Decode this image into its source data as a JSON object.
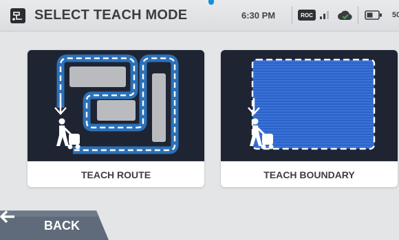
{
  "header": {
    "title": "SELECT TEACH MODE",
    "time": "6:30 PM",
    "mode_badge": "ROC",
    "battery_text": "50"
  },
  "cards": [
    {
      "label": "TEACH ROUTE",
      "icon": "route-illustration"
    },
    {
      "label": "TEACH BOUNDARY",
      "icon": "boundary-illustration"
    }
  ],
  "footer": {
    "back_label": "BACK"
  },
  "colors": {
    "accent": "#1b8fd6",
    "card_image_bg": "#1f2433",
    "back_button": "#5f6b7a"
  }
}
